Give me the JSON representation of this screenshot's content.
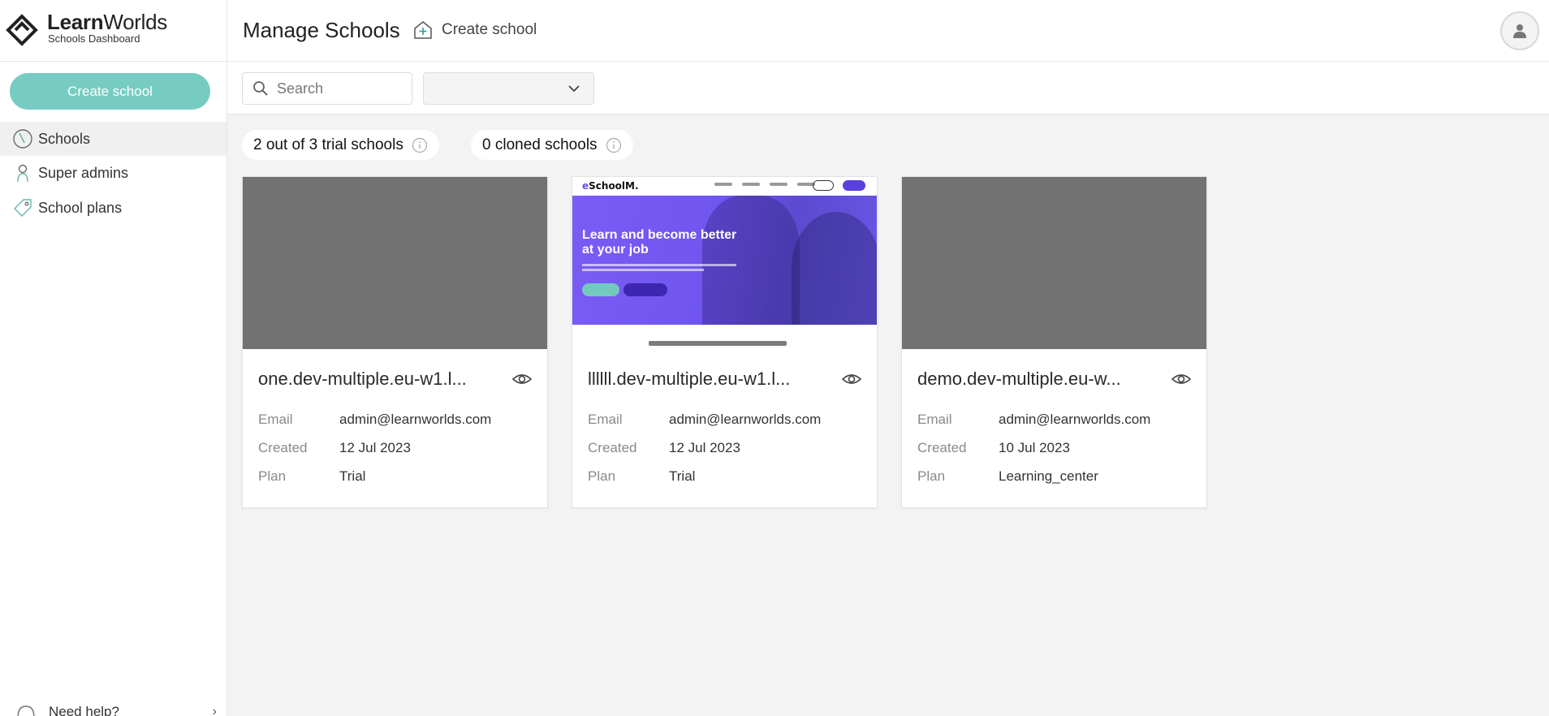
{
  "brand": {
    "name_bold": "Learn",
    "name_light": "Worlds",
    "subtitle": "Schools Dashboard"
  },
  "sidebar": {
    "create_label": "Create school",
    "items": [
      {
        "label": "Schools",
        "icon": "schools-icon",
        "active": true
      },
      {
        "label": "Super admins",
        "icon": "super-admin-icon",
        "active": false
      },
      {
        "label": "School plans",
        "icon": "tag-icon",
        "active": false
      }
    ],
    "help_label": "Need help?"
  },
  "header": {
    "title": "Manage Schools",
    "create_label": "Create school"
  },
  "filters": {
    "search_placeholder": "Search",
    "select_value": ""
  },
  "badges": {
    "trial": "2 out of 3 trial schools",
    "cloned": "0 cloned schools"
  },
  "cards": [
    {
      "title": "one.dev-multiple.eu-w1.l...",
      "labels": {
        "email": "Email",
        "created": "Created",
        "plan": "Plan"
      },
      "email": "admin@learnworlds.com",
      "created": "12 Jul 2023",
      "plan": "Trial"
    },
    {
      "title": "llllll.dev-multiple.eu-w1.l...",
      "labels": {
        "email": "Email",
        "created": "Created",
        "plan": "Plan"
      },
      "email": "admin@learnworlds.com",
      "created": "12 Jul 2023",
      "plan": "Trial",
      "preview": {
        "logo_accent": "e",
        "logo_rest": "SchoolM.",
        "headline": "Learn and become better at your job"
      }
    },
    {
      "title": "demo.dev-multiple.eu-w...",
      "labels": {
        "email": "Email",
        "created": "Created",
        "plan": "Plan"
      },
      "email": "admin@learnworlds.com",
      "created": "10 Jul 2023",
      "plan": "Learning_center"
    }
  ],
  "colors": {
    "accent": "#76ccc2",
    "thumb_placeholder": "#727272",
    "preview_purple": "#7055ef"
  }
}
